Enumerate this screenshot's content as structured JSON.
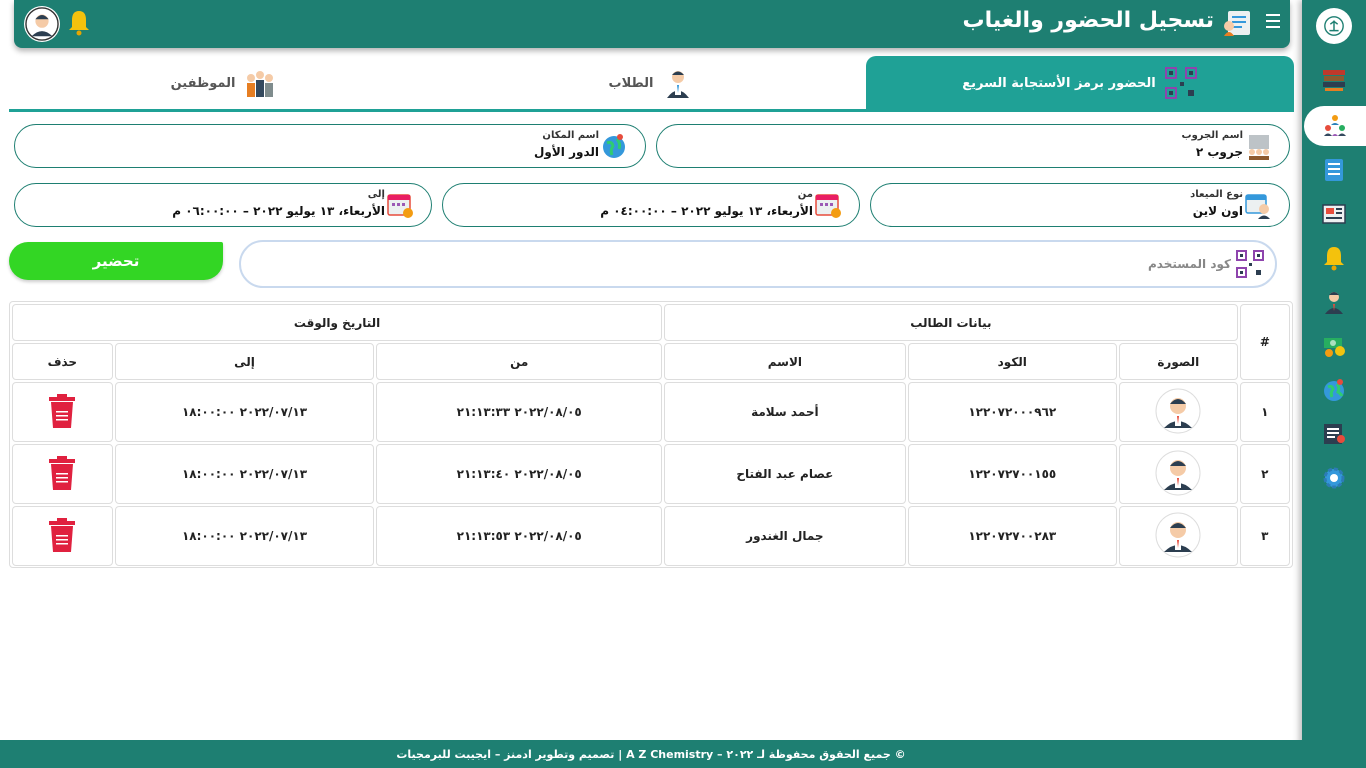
{
  "header": {
    "title": "تسجيل الحضور والغياب"
  },
  "tabs": [
    {
      "label": "الحضور برمز الأستجابة السريع",
      "active": true
    },
    {
      "label": "الطلاب",
      "active": false
    },
    {
      "label": "الموظفين",
      "active": false
    }
  ],
  "fields": {
    "group": {
      "label": "اسم الجروب",
      "value": "جروب ٢"
    },
    "place": {
      "label": "اسم المكان",
      "value": "الدور الأول"
    },
    "appointment_type": {
      "label": "نوع الميعاد",
      "value": "اون لاين"
    },
    "from": {
      "label": "من",
      "value": "الأربعاء، ١٣ يوليو ٢٠٢٢ – ٠٤:٠٠:٠٠ م"
    },
    "to": {
      "label": "إلى",
      "value": "الأربعاء، ١٣ يوليو ٢٠٢٢ – ٠٦:٠٠:٠٠ م"
    }
  },
  "code": {
    "placeholder": "كود المستخدم",
    "value": ""
  },
  "attend_button": "تحضير",
  "table": {
    "group_headers": {
      "number": "#",
      "student_data": "بيانات الطالب",
      "datetime": "التاريخ والوقت"
    },
    "columns": {
      "photo": "الصورة",
      "code": "الكود",
      "name": "الاسم",
      "from": "من",
      "to": "إلى",
      "delete": "حذف"
    },
    "rows": [
      {
        "num": "١",
        "code": "١٢٢٠٧٢٠٠٠٩٦٢",
        "name": "أحمد سلامة",
        "from": "٢٠٢٢/٠٨/٠٥ ٢١:١٣:٣٣",
        "to": "٢٠٢٢/٠٧/١٣ ١٨:٠٠:٠٠"
      },
      {
        "num": "٢",
        "code": "١٢٢٠٧٢٧٠٠١٥٥",
        "name": "عصام عبد الفتاح",
        "from": "٢٠٢٢/٠٨/٠٥ ٢١:١٣:٤٠",
        "to": "٢٠٢٢/٠٧/١٣ ١٨:٠٠:٠٠"
      },
      {
        "num": "٣",
        "code": "١٢٢٠٧٢٧٠٠٢٨٣",
        "name": "جمال الغندور",
        "from": "٢٠٢٢/٠٨/٠٥ ٢١:١٣:٥٣",
        "to": "٢٠٢٢/٠٧/١٣ ١٨:٠٠:٠٠"
      }
    ]
  },
  "footer": "© جميع الحقوق محفوظة لـ ٢٠٢٢ – A Z Chemistry | تصميم وتطوير ادمنز – ايجيبت للبرمجيات",
  "colors": {
    "primary": "#1e7f72",
    "tab_active": "#1fa196",
    "attend_button": "#33d624",
    "delete": "#e0213f"
  },
  "sidebar_icons": [
    "logo-icon",
    "books-icon",
    "group-icon",
    "checklist-icon",
    "newspaper-icon",
    "bell-icon",
    "teacher-icon",
    "money-icon",
    "globe-icon",
    "report-icon",
    "settings-icon"
  ]
}
